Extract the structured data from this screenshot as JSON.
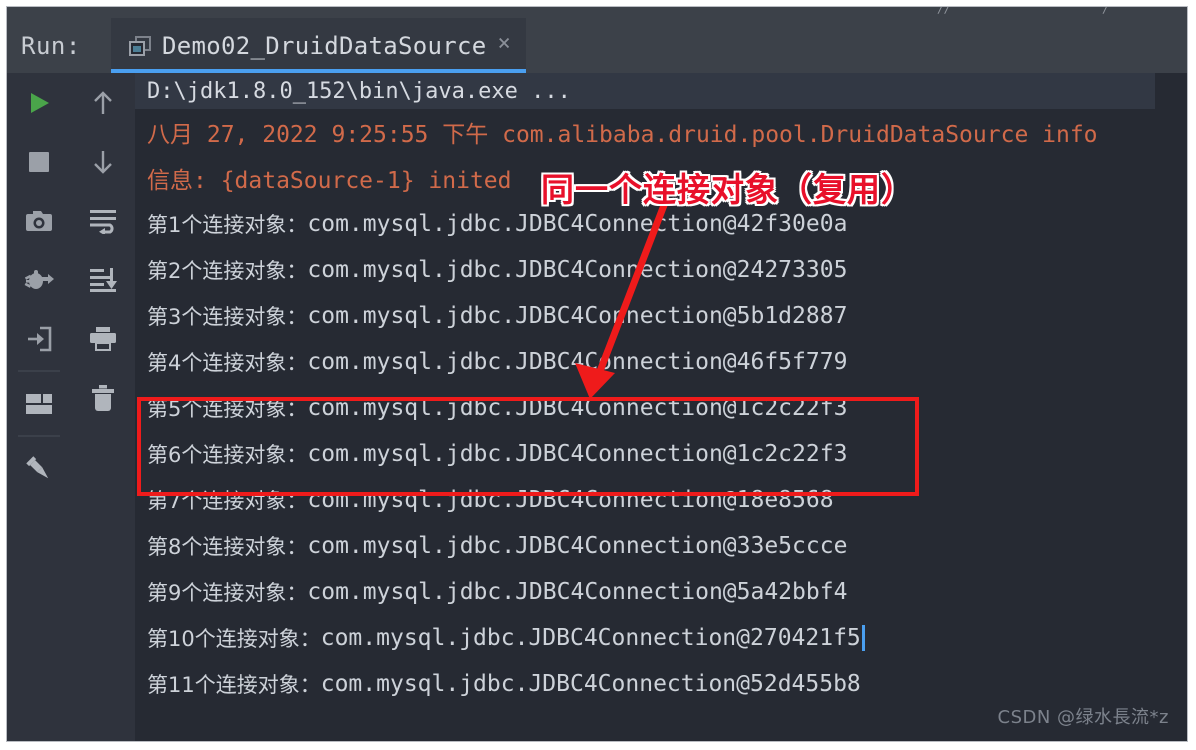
{
  "window": {
    "run_label": "Run:",
    "tab_title": "Demo02_DruidDataSource",
    "tab_close": "×",
    "tab_icon": "window-icon"
  },
  "toolbar": {
    "left_column": [
      {
        "name": "rerun-button",
        "icon": "play-icon",
        "label": "Rerun"
      },
      {
        "name": "stop-button",
        "icon": "stop-square-icon",
        "label": "Stop"
      },
      {
        "name": "screenshot-button",
        "icon": "camera-icon",
        "label": "Camera"
      },
      {
        "name": "dump-threads-button",
        "icon": "bug-icon",
        "label": "Dump Threads"
      },
      {
        "name": "restore-layout-button",
        "icon": "import-arrow-icon",
        "label": "Restore Layout"
      },
      {
        "name": "layout-settings-button",
        "icon": "layout-icon",
        "label": "Layout"
      },
      {
        "name": "pin-tab-button",
        "icon": "pin-icon",
        "label": "Pin Tab"
      }
    ],
    "right_column": [
      {
        "name": "previous-occurrence-button",
        "icon": "arrow-up-icon",
        "label": "Up the Stack Trace"
      },
      {
        "name": "next-occurrence-button",
        "icon": "arrow-down-icon",
        "label": "Down the Stack Trace"
      },
      {
        "name": "soft-wrap-button",
        "icon": "soft-wrap-icon",
        "label": "Soft-Wrap"
      },
      {
        "name": "scroll-to-end-button",
        "icon": "scroll-to-end-icon",
        "label": "Scroll to End"
      },
      {
        "name": "print-button",
        "icon": "printer-icon",
        "label": "Print"
      },
      {
        "name": "clear-all-button",
        "icon": "trash-icon",
        "label": "Clear All"
      }
    ]
  },
  "console": {
    "command_line": "D:\\jdk1.8.0_152\\bin\\java.exe ...",
    "log_lines": [
      "八月 27, 2022 9:25:55 下午 com.alibaba.druid.pool.DruidDataSource info",
      "信息: {dataSource-1} inited"
    ],
    "connections": [
      {
        "label": "第1个连接对象：",
        "value": "com.mysql.jdbc.JDBC4Connection@42f30e0a"
      },
      {
        "label": "第2个连接对象：",
        "value": "com.mysql.jdbc.JDBC4Connection@24273305"
      },
      {
        "label": "第3个连接对象：",
        "value": "com.mysql.jdbc.JDBC4Connection@5b1d2887"
      },
      {
        "label": "第4个连接对象：",
        "value": "com.mysql.jdbc.JDBC4Connection@46f5f779"
      },
      {
        "label": "第5个连接对象：",
        "value": "com.mysql.jdbc.JDBC4Connection@1c2c22f3"
      },
      {
        "label": "第6个连接对象：",
        "value": "com.mysql.jdbc.JDBC4Connection@1c2c22f3"
      },
      {
        "label": "第7个连接对象：",
        "value": "com.mysql.jdbc.JDBC4Connection@18e8568"
      },
      {
        "label": "第8个连接对象：",
        "value": "com.mysql.jdbc.JDBC4Connection@33e5ccce"
      },
      {
        "label": "第9个连接对象：",
        "value": "com.mysql.jdbc.JDBC4Connection@5a42bbf4"
      },
      {
        "label": "第10个连接对象：",
        "value": "com.mysql.jdbc.JDBC4Connection@270421f5"
      },
      {
        "label": "第11个连接对象：",
        "value": "com.mysql.jdbc.JDBC4Connection@52d455b8"
      }
    ],
    "caret_after_line_index": 9
  },
  "annotation": {
    "text": "同一个连接对象（复用）",
    "color": "#e8102a",
    "box_color": "#ef1b1b",
    "highlighted_lines": [
      5,
      6
    ]
  },
  "watermark": {
    "text": "CSDN @绿水長流*z"
  },
  "colors": {
    "console_background": "#262a33",
    "toolbar_background": "#2f333d",
    "header_background": "#3c4149",
    "tab_background": "#343942",
    "tab_underline": "#4a9ff0",
    "log_text": "#d16a4a",
    "console_text": "#cdd2d9",
    "caret": "#4a9ff0"
  }
}
